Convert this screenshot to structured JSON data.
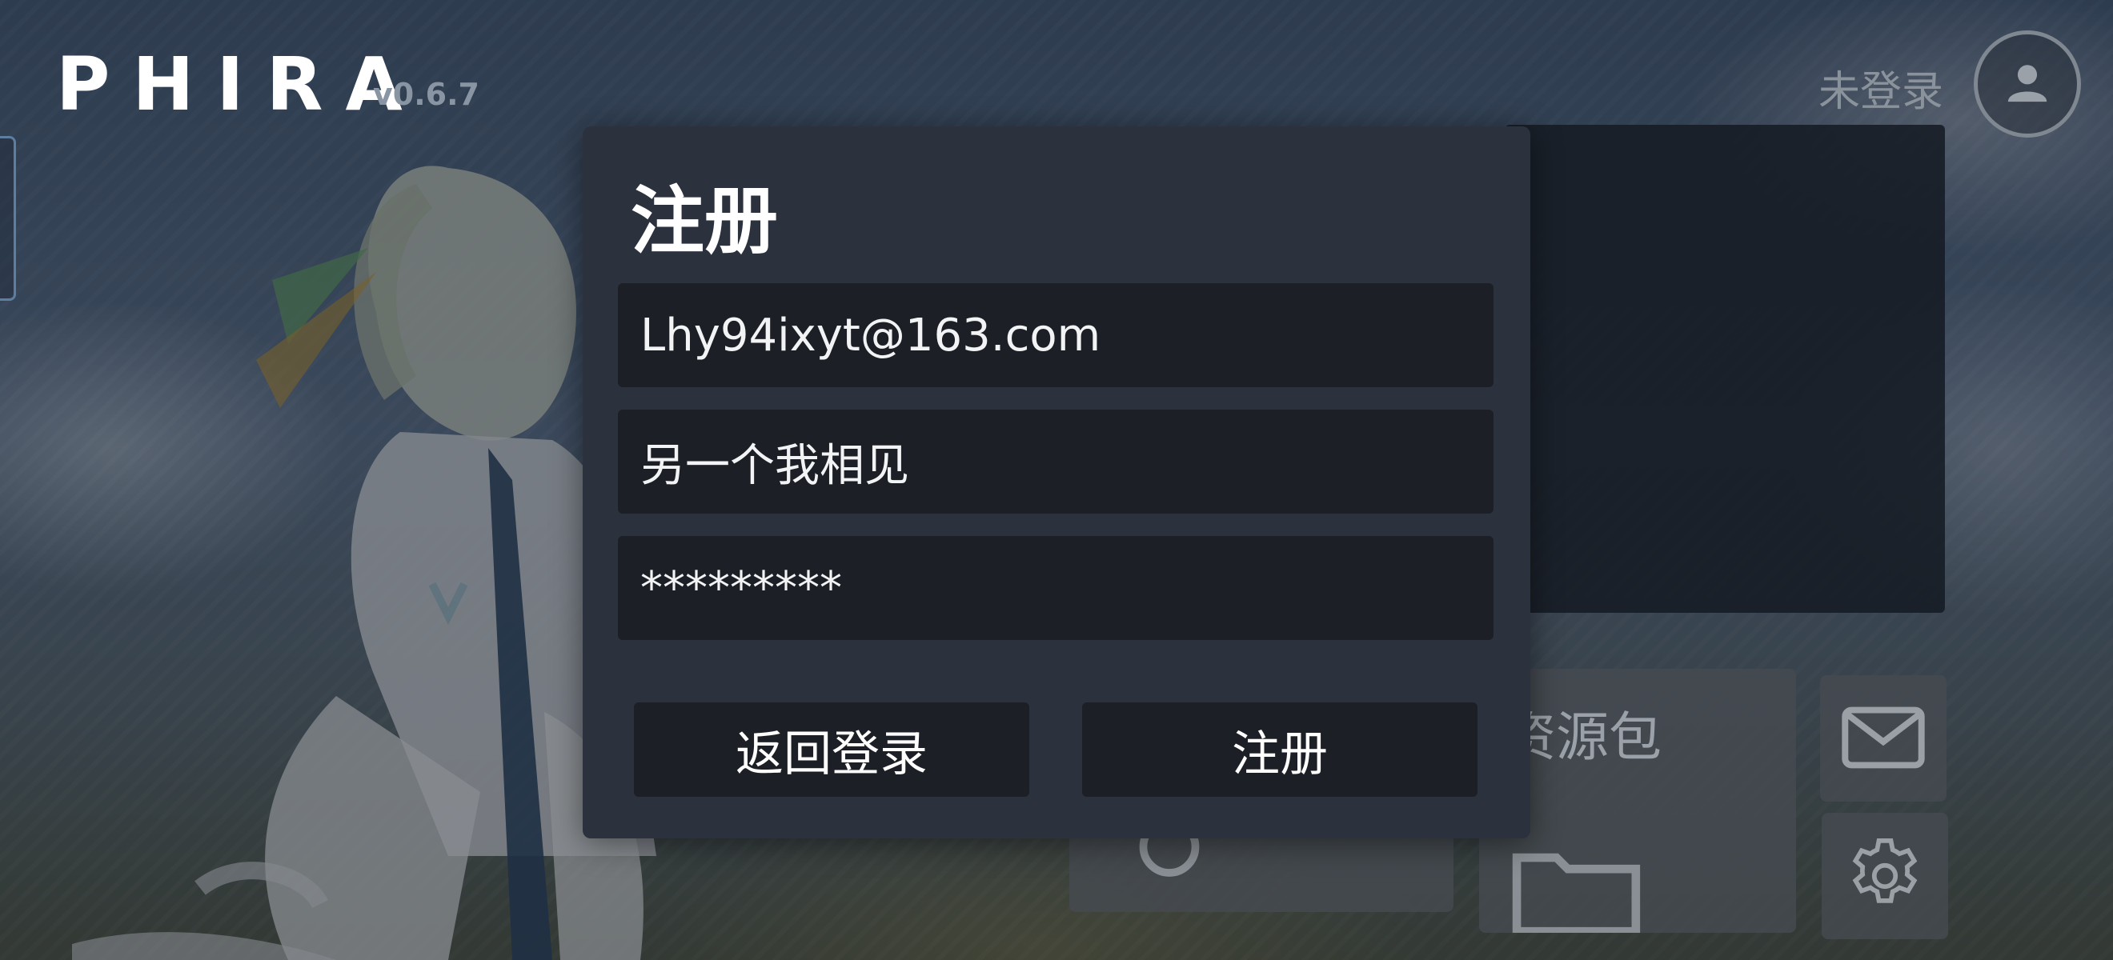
{
  "app": {
    "logo": "PHIRA",
    "version": "v0.6.7"
  },
  "header": {
    "login_status": "未登录"
  },
  "background": {
    "resource_pack_label": "资源包"
  },
  "dialog": {
    "title": "注册",
    "email_value": "Lhy94ixyt@163.com",
    "username_value": "另一个我相见",
    "password_value": "*********",
    "back_button": "返回登录",
    "register_button": "注册"
  },
  "icons": [
    "user-icon",
    "mail-icon",
    "gear-icon",
    "folder-icon",
    "bulb-icon"
  ]
}
